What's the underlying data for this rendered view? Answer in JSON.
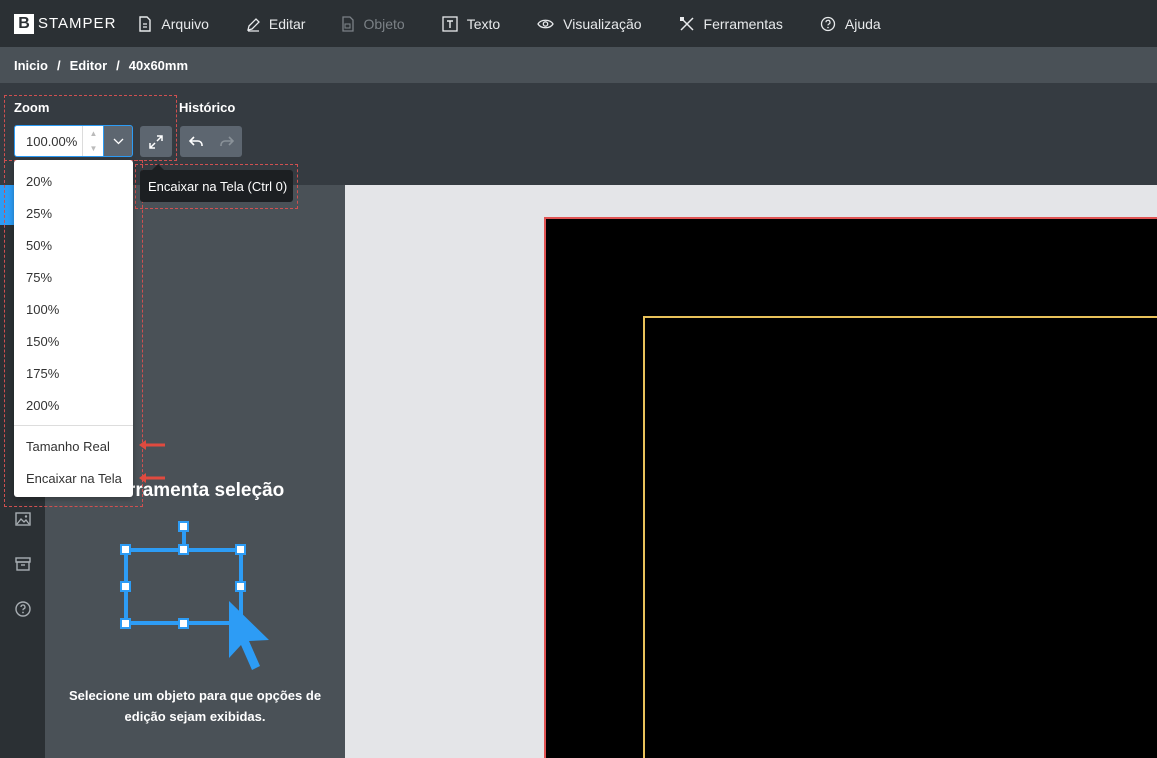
{
  "app": {
    "logo_letter": "B",
    "logo_text": "STAMPER"
  },
  "menu": [
    {
      "label": "Arquivo",
      "icon": "file-icon"
    },
    {
      "label": "Editar",
      "icon": "pencil-icon"
    },
    {
      "label": "Objeto",
      "icon": "object-icon",
      "disabled": true
    },
    {
      "label": "Texto",
      "icon": "text-icon"
    },
    {
      "label": "Visualização",
      "icon": "eye-icon"
    },
    {
      "label": "Ferramentas",
      "icon": "tools-icon"
    },
    {
      "label": "Ajuda",
      "icon": "help-icon"
    }
  ],
  "breadcrumb": {
    "items": [
      "Inicio",
      "Editor",
      "40x60mm"
    ],
    "separator": "/"
  },
  "toolbar": {
    "zoom_label": "Zoom",
    "zoom_value": "100.00%",
    "history_label": "Histórico",
    "fit_tooltip": "Encaixar na Tela (Ctrl 0)"
  },
  "zoom_options": [
    "20%",
    "25%",
    "50%",
    "75%",
    "100%",
    "150%",
    "175%",
    "200%"
  ],
  "zoom_actions": [
    "Tamanho Real",
    "Encaixar na Tela"
  ],
  "panel": {
    "title": "Ferramenta seleção",
    "description": "Selecione um objeto para que opções de edição sejam exibidas."
  },
  "colors": {
    "accent": "#2d9cf5",
    "artboard_border": "#e05353",
    "safe_area": "#e8c15a",
    "annotation": "#e04a3f"
  }
}
